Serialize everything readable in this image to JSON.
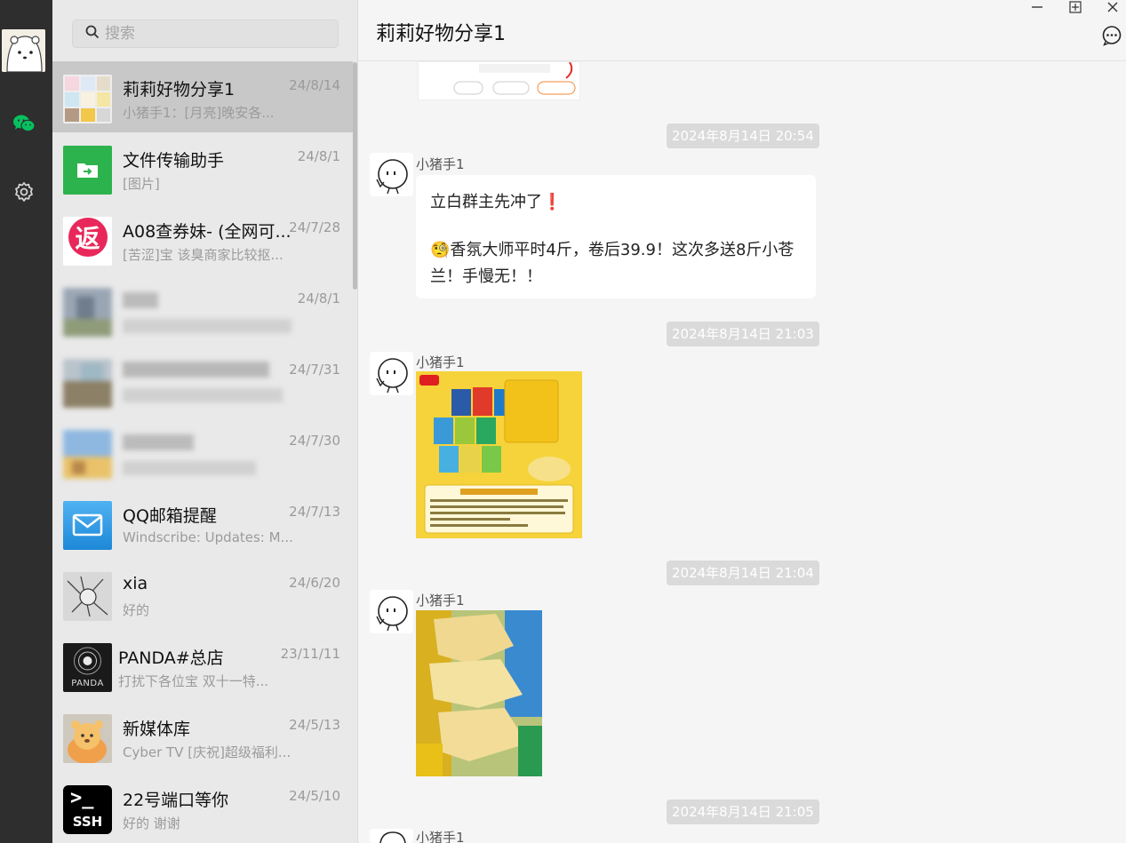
{
  "window": {
    "controls": [
      "minimize-icon",
      "maximize-icon",
      "close-icon"
    ]
  },
  "nav": {
    "items": [
      {
        "icon": "chat-icon",
        "active": true
      },
      {
        "icon": "settings-icon"
      }
    ],
    "accent_color": "#07c160"
  },
  "search": {
    "placeholder": "搜索"
  },
  "conversations": [
    {
      "name": "莉莉好物分享1",
      "time": "24/8/14",
      "preview": "小猪手1：[月亮]晚安各...",
      "active": true
    },
    {
      "name": "文件传输助手",
      "time": "24/8/1",
      "preview": "[图片]"
    },
    {
      "name": "A08查券妹- (全网可...",
      "time": "24/7/28",
      "preview": "[苦涩]宝 该臭商家比较抠..."
    },
    {
      "name": "",
      "time": "24/8/1",
      "preview": "",
      "blurred": true
    },
    {
      "name": "",
      "time": "24/7/31",
      "preview": "",
      "blurred": true
    },
    {
      "name": "",
      "time": "24/7/30",
      "preview": "",
      "blurred": true
    },
    {
      "name": "QQ邮箱提醒",
      "time": "24/7/13",
      "preview": "Windscribe: Updates: M..."
    },
    {
      "name": "xia",
      "time": "24/6/20",
      "preview": "好的"
    },
    {
      "name": "PANDA#总店",
      "time": "23/11/11",
      "preview": "打扰下各位宝 双十一特..."
    },
    {
      "name": "新媒体库",
      "time": "24/5/13",
      "preview": "Cyber TV [庆祝]超级福利..."
    },
    {
      "name": "22号端口等你",
      "time": "24/5/10",
      "preview": "好的 谢谢"
    }
  ],
  "avatar_text": {
    "fanli": "返",
    "panda": "PANDA",
    "ssh": "SSH",
    "ssh_prompt": ">_"
  },
  "chat": {
    "title": "莉莉好物分享1",
    "messages": [
      {
        "time": "2024年8月14日 20:54",
        "sender": "小猪手1",
        "line1": "立白群主先冲了",
        "line1_emoji": "❗",
        "line2_emoji": "🧐",
        "line2": "香氛大师平时4斤，卷后39.9！这次多送8斤小苍兰！手慢无！！"
      },
      {
        "time": "2024年8月14日 21:03",
        "sender": "小猪手1",
        "type": "image"
      },
      {
        "time": "2024年8月14日 21:04",
        "sender": "小猪手1",
        "type": "image"
      },
      {
        "time": "2024年8月14日 21:05",
        "sender": "小猪手1"
      }
    ]
  }
}
